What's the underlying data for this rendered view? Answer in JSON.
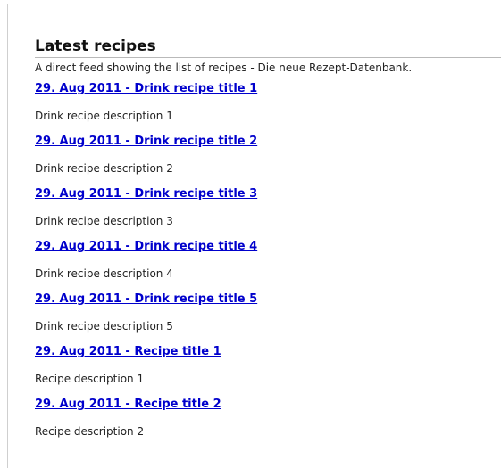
{
  "feed": {
    "title": "Latest recipes",
    "subtitle": "A direct feed showing the list of recipes - Die neue Rezept-Datenbank."
  },
  "colors": {
    "link": "#0000cc",
    "text": "#222222",
    "divider": "#b9b9b9"
  },
  "items": [
    {
      "title": "29. Aug 2011 - Drink recipe title 1",
      "description": "Drink recipe description 1"
    },
    {
      "title": "29. Aug 2011 - Drink recipe title 2",
      "description": "Drink recipe description 2"
    },
    {
      "title": "29. Aug 2011 - Drink recipe title 3",
      "description": "Drink recipe description 3"
    },
    {
      "title": "29. Aug 2011 - Drink recipe title 4",
      "description": "Drink recipe description 4"
    },
    {
      "title": "29. Aug 2011 - Drink recipe title 5",
      "description": "Drink recipe description 5"
    },
    {
      "title": "29. Aug 2011 - Recipe title 1",
      "description": "Recipe description 1"
    },
    {
      "title": "29. Aug 2011 - Recipe title 2",
      "description": "Recipe description 2"
    }
  ]
}
